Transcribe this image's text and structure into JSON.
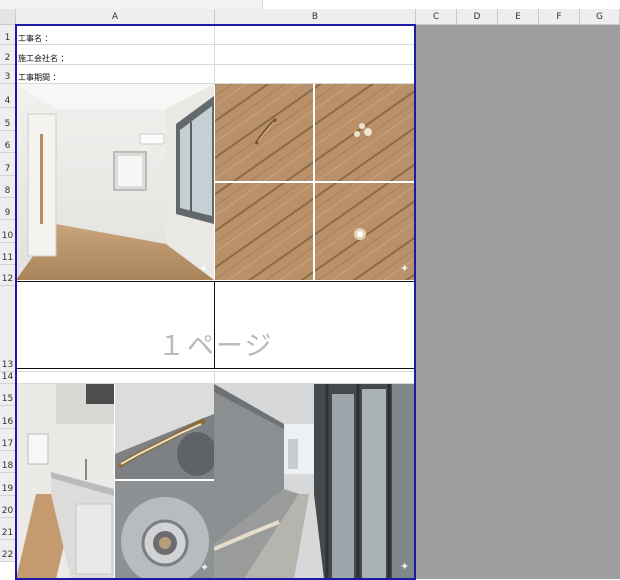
{
  "columns": [
    "A",
    "B",
    "C",
    "D",
    "E",
    "F",
    "G"
  ],
  "rows": [
    "1",
    "2",
    "3",
    "4",
    "5",
    "6",
    "7",
    "8",
    "9",
    "10",
    "11",
    "12",
    "13",
    "14",
    "15",
    "16",
    "17",
    "18",
    "19",
    "20",
    "21",
    "22"
  ],
  "form": {
    "project_name": "工事名 ：",
    "contractor": "施工会社名 ：",
    "period": "工事期間 ："
  },
  "page_label": "１ページ",
  "icons": {
    "photo_badge": "sparkle-icon"
  }
}
